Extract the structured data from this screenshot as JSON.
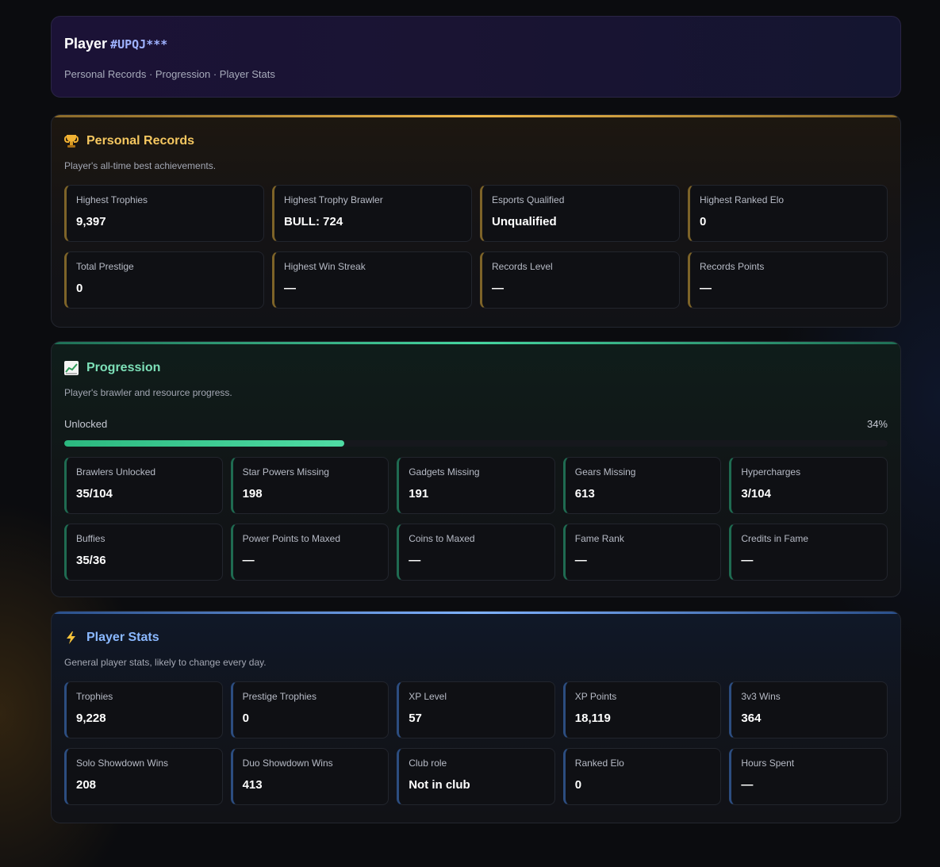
{
  "header": {
    "title": "Player",
    "tag": "#UPQJ***",
    "subtitle": "Personal Records · Progression · Player Stats"
  },
  "records": {
    "title": "Personal Records",
    "icon": "trophy-icon",
    "accent": "#f0b84a",
    "description": "Player's all-time best achievements.",
    "cards": [
      {
        "label": "Highest Trophies",
        "value": "9,397"
      },
      {
        "label": "Highest Trophy Brawler",
        "value": "BULL: 724"
      },
      {
        "label": "Esports Qualified",
        "value": "Unqualified"
      },
      {
        "label": "Highest Ranked Elo",
        "value": "0"
      },
      {
        "label": "Total Prestige",
        "value": "0"
      },
      {
        "label": "Highest Win Streak",
        "value": "—"
      },
      {
        "label": "Records Level",
        "value": "—"
      },
      {
        "label": "Records Points",
        "value": "—"
      }
    ]
  },
  "progression": {
    "title": "Progression",
    "icon": "chart-icon",
    "accent": "#46d6a0",
    "description": "Player's brawler and resource progress.",
    "bar_label": "Unlocked",
    "bar_percent_text": "34%",
    "bar_fraction": 0.34,
    "cards": [
      {
        "label": "Brawlers Unlocked",
        "value": "35/104"
      },
      {
        "label": "Star Powers Missing",
        "value": "198"
      },
      {
        "label": "Gadgets Missing",
        "value": "191"
      },
      {
        "label": "Gears Missing",
        "value": "613"
      },
      {
        "label": "Hypercharges",
        "value": "3/104"
      },
      {
        "label": "Buffies",
        "value": "35/36"
      },
      {
        "label": "Power Points to Maxed",
        "value": "—"
      },
      {
        "label": "Coins to Maxed",
        "value": "—"
      },
      {
        "label": "Fame Rank",
        "value": "—"
      },
      {
        "label": "Credits in Fame",
        "value": "—"
      }
    ]
  },
  "stats": {
    "title": "Player Stats",
    "icon": "lightning-icon",
    "accent": "#7fb2ff",
    "description": "General player stats, likely to change every day.",
    "cards": [
      {
        "label": "Trophies",
        "value": "9,228"
      },
      {
        "label": "Prestige Trophies",
        "value": "0"
      },
      {
        "label": "XP Level",
        "value": "57"
      },
      {
        "label": "XP Points",
        "value": "18,119"
      },
      {
        "label": "3v3 Wins",
        "value": "364"
      },
      {
        "label": "Solo Showdown Wins",
        "value": "208"
      },
      {
        "label": "Duo Showdown Wins",
        "value": "413"
      },
      {
        "label": "Club role",
        "value": "Not in club"
      },
      {
        "label": "Ranked Elo",
        "value": "0"
      },
      {
        "label": "Hours Spent",
        "value": "—"
      }
    ]
  }
}
